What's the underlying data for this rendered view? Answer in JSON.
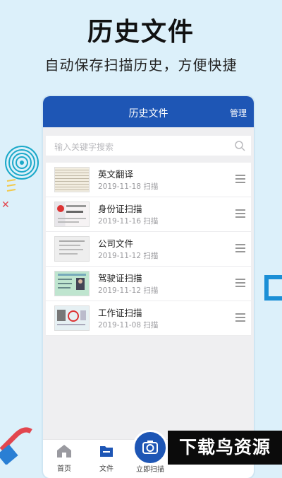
{
  "hero": {
    "title": "历史文件",
    "subtitle": "自动保存扫描历史，方便快捷"
  },
  "nav": {
    "title": "历史文件",
    "manage": "管理"
  },
  "search": {
    "placeholder": "输入关键字搜索"
  },
  "files": [
    {
      "title": "英文翻译",
      "date": "2019-11-18 扫描"
    },
    {
      "title": "身份证扫描",
      "date": "2019-11-16 扫描"
    },
    {
      "title": "公司文件",
      "date": "2019-11-12 扫描"
    },
    {
      "title": "驾驶证扫描",
      "date": "2019-11-12 扫描"
    },
    {
      "title": "工作证扫描",
      "date": "2019-11-08 扫描"
    }
  ],
  "tabbar": {
    "home": "首页",
    "files": "文件",
    "scan": "立即扫描"
  },
  "watermark": "下载鸟资源",
  "colors": {
    "accent": "#1e56b5",
    "background": "#dcf0fa"
  }
}
